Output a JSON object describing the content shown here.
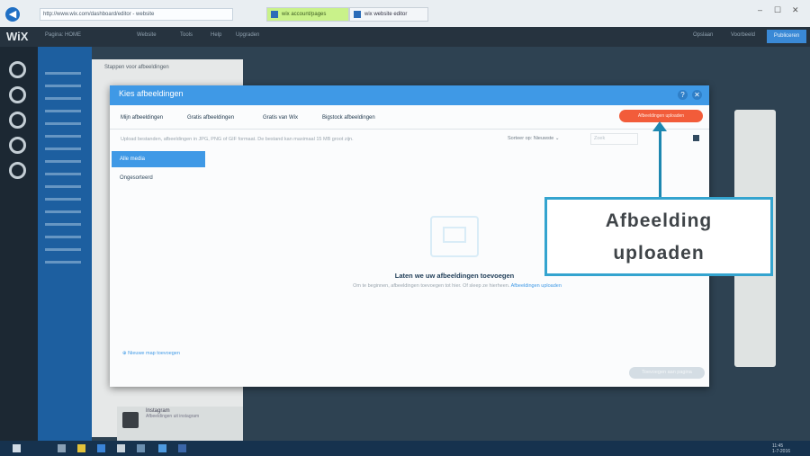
{
  "browser": {
    "url": "http://www.wix.com/dashboard/editor - website",
    "tabs": [
      {
        "label": "wix account/pages"
      },
      {
        "label": "wix website editor"
      }
    ],
    "window_controls": [
      "–",
      "☐",
      "✕"
    ]
  },
  "editor": {
    "logo": "WiX",
    "top_items": [
      "Pagina: HOME",
      "Website",
      "Tools",
      "Help",
      "Upgraden"
    ],
    "right_items": [
      "Opslaan",
      "Voorbeeld"
    ],
    "publish_label": "Publiceren",
    "background_panel_title": "Stappen voor afbeeldingen"
  },
  "modal": {
    "title": "Kies afbeeldingen",
    "tabs": [
      "Mijn afbeeldingen",
      "Gratis afbeeldingen",
      "Gratis van Wix",
      "Bigstock afbeeldingen"
    ],
    "upload_button": "Afbeeldingen uploaden",
    "info_text": "Upload bestanden, afbeeldingen in JPG, PNG of GIF formaat. De bestand kan maximaal 15 MB groot zijn.",
    "sort_label": "Sorteer op: Nieuwste",
    "search_placeholder": "Zoek",
    "folders": [
      "Alle media",
      "Ongesorteerd"
    ],
    "empty_title": "Laten we uw afbeeldingen toevoegen",
    "empty_desc": "Om te beginnen, afbeeldingen toevoegen tot hier. Of sleep ze hierheen.",
    "empty_link": "Afbeeldingen uploaden",
    "new_folder": "Nieuwe map toevoegen",
    "confirm_button": "Toevoegen aan pagina"
  },
  "callout": {
    "line1": "Afbeelding",
    "line2": "uploaden",
    "color": "#34a4cf"
  },
  "bottom_card": {
    "title": "Instagram",
    "subtitle": "Afbeeldingen uit instagram"
  },
  "tray": {
    "time": "11:45",
    "date": "1-7-2016"
  }
}
